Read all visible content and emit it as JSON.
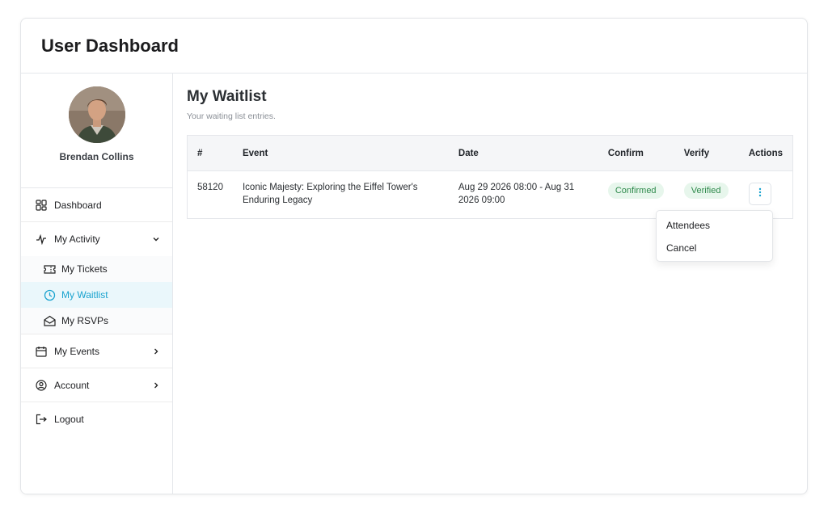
{
  "header": {
    "title": "User Dashboard"
  },
  "profile": {
    "name": "Brendan Collins"
  },
  "sidebar": {
    "dashboard": "Dashboard",
    "my_activity": "My Activity",
    "my_activity_items": [
      "My Tickets",
      "My Waitlist",
      "My RSVPs"
    ],
    "my_events": "My Events",
    "account": "Account",
    "logout": "Logout"
  },
  "main": {
    "title": "My Waitlist",
    "subtitle": "Your waiting list entries."
  },
  "table": {
    "columns": [
      "#",
      "Event",
      "Date",
      "Confirm",
      "Verify",
      "Actions"
    ],
    "rows": [
      {
        "id": "58120",
        "event": "Iconic Majesty: Exploring the Eiffel Tower's Enduring Legacy",
        "date": "Aug 29 2026 08:00 - Aug 31 2026 09:00",
        "confirm": "Confirmed",
        "verify": "Verified"
      }
    ]
  },
  "dropdown": {
    "items": [
      "Attendees",
      "Cancel"
    ]
  },
  "colors": {
    "accent": "#1aa3cf",
    "badge_bg": "#e7f6ec",
    "badge_text": "#2f8a4c"
  }
}
